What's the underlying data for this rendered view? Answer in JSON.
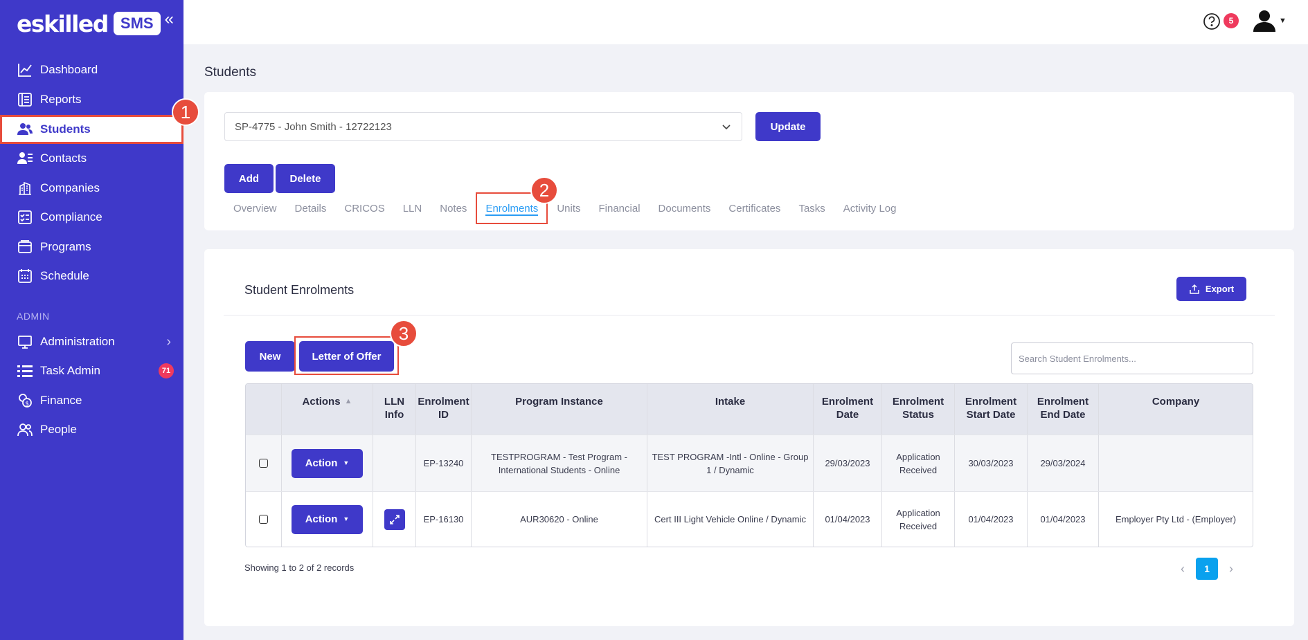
{
  "app": {
    "logo_text": "eskilled",
    "logo_badge": "SMS"
  },
  "sidebar": {
    "items": [
      {
        "label": "Dashboard",
        "icon": "chart-line-icon"
      },
      {
        "label": "Reports",
        "icon": "report-icon"
      },
      {
        "label": "Students",
        "icon": "students-icon",
        "active": true
      },
      {
        "label": "Contacts",
        "icon": "contacts-icon"
      },
      {
        "label": "Companies",
        "icon": "building-icon"
      },
      {
        "label": "Compliance",
        "icon": "checklist-icon"
      },
      {
        "label": "Programs",
        "icon": "programs-icon"
      },
      {
        "label": "Schedule",
        "icon": "calendar-icon"
      }
    ],
    "admin_heading": "ADMIN",
    "admin_items": [
      {
        "label": "Administration",
        "icon": "monitor-icon"
      },
      {
        "label": "Task Admin",
        "icon": "task-list-icon",
        "badge": "71"
      },
      {
        "label": "Finance",
        "icon": "coins-icon"
      },
      {
        "label": "People",
        "icon": "people-icon"
      }
    ]
  },
  "topbar": {
    "notification_count": "5"
  },
  "page": {
    "title": "Students"
  },
  "student_select": {
    "value": "SP-4775 - John Smith - 12722123"
  },
  "buttons": {
    "update": "Update",
    "add": "Add",
    "delete": "Delete"
  },
  "tabs": [
    "Overview",
    "Details",
    "CRICOS",
    "LLN",
    "Notes",
    "Enrolments",
    "Units",
    "Financial",
    "Documents",
    "Certificates",
    "Tasks",
    "Activity Log"
  ],
  "active_tab": "Enrolments",
  "enrolments": {
    "title": "Student Enrolments",
    "export_label": "Export",
    "new_label": "New",
    "letter_label": "Letter of Offer",
    "search_placeholder": "Search Student Enrolments...",
    "columns": {
      "actions": "Actions",
      "lln": "LLN Info",
      "id": "Enrolment ID",
      "program": "Program Instance",
      "intake": "Intake",
      "date": "Enrolment Date",
      "status": "Enrolment Status",
      "start": "Enrolment Start Date",
      "end": "Enrolment End Date",
      "company": "Company"
    },
    "rows": [
      {
        "action": "Action",
        "id": "EP-13240",
        "program": "TESTPROGRAM - Test Program - International Students - Online",
        "intake": "TEST PROGRAM -Intl - Online - Group 1 / Dynamic",
        "date": "29/03/2023",
        "status": "Application Received",
        "start": "30/03/2023",
        "end": "29/03/2024",
        "company": ""
      },
      {
        "action": "Action",
        "id": "EP-16130",
        "program": "AUR30620 - Online",
        "intake": "Cert III Light Vehicle Online / Dynamic",
        "date": "01/04/2023",
        "status": "Application Received",
        "start": "01/04/2023",
        "end": "01/04/2023",
        "company": "Employer Pty Ltd - (Employer)"
      }
    ],
    "footer": "Showing 1 to 2 of 2 records",
    "current_page": "1"
  },
  "callouts": [
    "1",
    "2",
    "3"
  ],
  "colors": {
    "primary": "#3f39c9",
    "highlight": "#e74c3c",
    "tab_active": "#2a9cf4",
    "badge": "#ef3a5d"
  }
}
